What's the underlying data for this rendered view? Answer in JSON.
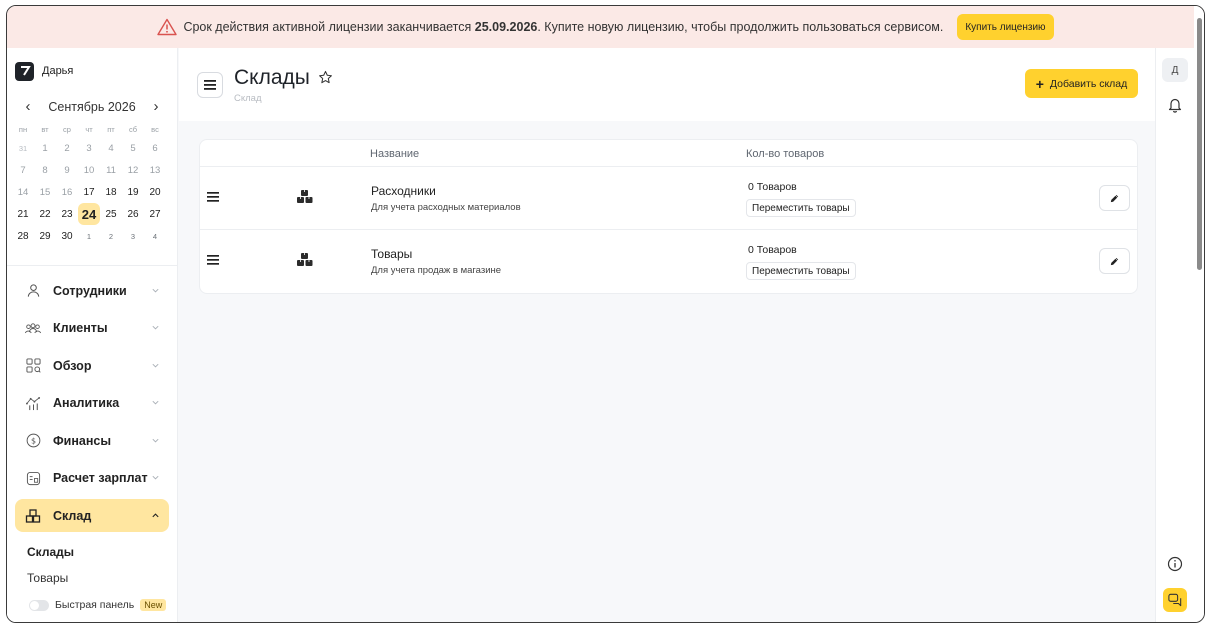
{
  "banner": {
    "text_before": "Срок действия активной лицензии заканчивается",
    "date": "25.09.2026",
    "text_after": ". Купите новую лицензию, чтобы продолжить пользоваться сервисом.",
    "buy_label": "Купить лицензию"
  },
  "user": {
    "name": "Дарья"
  },
  "calendar": {
    "month_label": "Сентябрь 2026",
    "weekdays": [
      "пн",
      "вт",
      "ср",
      "чт",
      "пт",
      "сб",
      "вс"
    ],
    "weeks": [
      [
        "31",
        "1",
        "2",
        "3",
        "4",
        "5",
        "6"
      ],
      [
        "7",
        "8",
        "9",
        "10",
        "11",
        "12",
        "13"
      ],
      [
        "14",
        "15",
        "16",
        "17",
        "18",
        "19",
        "20"
      ],
      [
        "21",
        "22",
        "23",
        "24",
        "25",
        "26",
        "27"
      ],
      [
        "28",
        "29",
        "30",
        "1",
        "2",
        "3",
        "4"
      ]
    ],
    "today": "24"
  },
  "nav": [
    {
      "label": "Сотрудники",
      "icon": "person-icon"
    },
    {
      "label": "Клиенты",
      "icon": "clients-icon"
    },
    {
      "label": "Обзор",
      "icon": "overview-icon"
    },
    {
      "label": "Аналитика",
      "icon": "analytics-icon"
    },
    {
      "label": "Финансы",
      "icon": "finance-icon"
    },
    {
      "label": "Расчет зарплат",
      "icon": "payroll-icon"
    },
    {
      "label": "Склад",
      "icon": "warehouse-icon"
    }
  ],
  "warehouse_sub": [
    "Склады",
    "Товары"
  ],
  "quick_panel": {
    "label": "Быстрая панель",
    "badge": "New"
  },
  "rail": {
    "avatar": "Д"
  },
  "page": {
    "title": "Склады",
    "breadcrumb": "Склад",
    "add_label": "Добавить склад"
  },
  "table": {
    "headers": [
      "Название",
      "Кол-во товаров"
    ],
    "rows": [
      {
        "name": "Расходники",
        "desc": "Для учета расходных материалов",
        "count": "0 Товаров",
        "move": "Переместить товары"
      },
      {
        "name": "Товары",
        "desc": "Для учета продаж в магазине",
        "count": "0 Товаров",
        "move": "Переместить товары"
      }
    ]
  },
  "colors": {
    "accent": "#ffd12e",
    "highlight": "#ffe6a0",
    "banner_bg": "#fbe9e6",
    "warning": "#d9534f"
  }
}
